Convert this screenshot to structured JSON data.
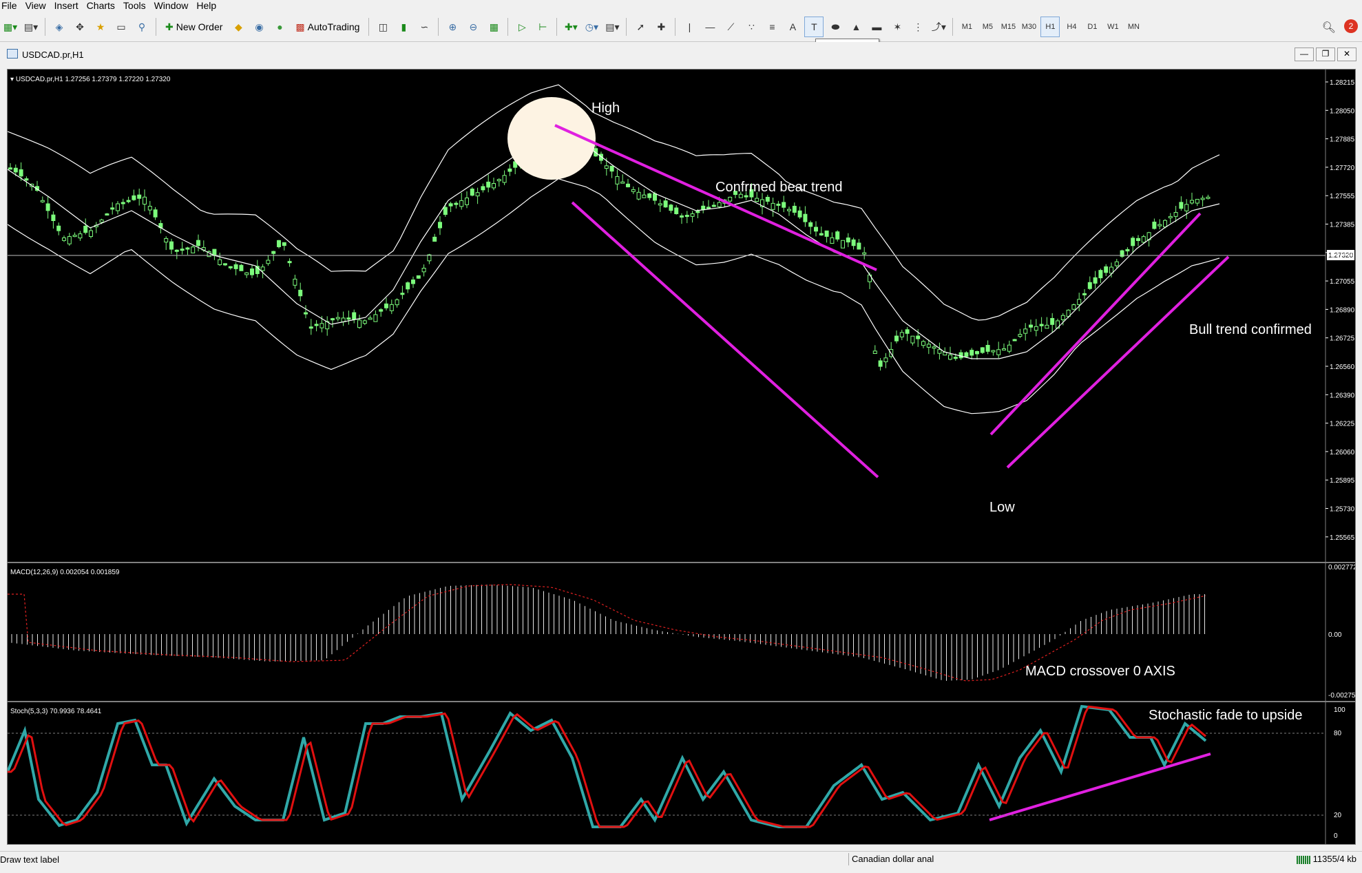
{
  "menu": [
    "File",
    "View",
    "Insert",
    "Charts",
    "Tools",
    "Window",
    "Help"
  ],
  "toolbar": {
    "new_order": "New Order",
    "auto_trading": "AutoTrading",
    "timeframes": [
      "M1",
      "M5",
      "M15",
      "M30",
      "H1",
      "H4",
      "D1",
      "W1",
      "MN"
    ],
    "active_timeframe": "H1",
    "tooltip": "Draw text label",
    "notification_count": "2",
    "icons": [
      "new-chart-icon",
      "profiles-icon",
      "market-watch-icon",
      "data-window-icon",
      "navigator-icon",
      "terminal-icon",
      "tester-icon",
      "metaeditor-icon",
      "signals-icon",
      "market-icon",
      "bar-chart-icon",
      "candle-chart-icon",
      "line-chart-icon",
      "zoom-in-icon",
      "zoom-out-icon",
      "tile-icon",
      "autoscroll-icon",
      "chart-shift-icon",
      "indicators-icon",
      "periods-icon",
      "templates-icon",
      "cursor-icon",
      "crosshair-icon",
      "vertical-line-icon",
      "horizontal-line-icon",
      "trendline-icon",
      "channel-icon",
      "fibo-icon",
      "text-icon",
      "text-label-icon",
      "ellipse-icon",
      "triangle-icon",
      "rectangle-icon",
      "gann-icon",
      "andrews-icon",
      "arrows-icon",
      "search-icon"
    ]
  },
  "chart_tab": "USDCAD.pr,H1",
  "chart": {
    "header": "USDCAD.pr,H1  1.27256 1.27379 1.27220 1.27320",
    "price_labels": [
      "1.28215",
      "1.28050",
      "1.27885",
      "1.27720",
      "1.27555",
      "1.27385",
      "1.27220",
      "1.27055",
      "1.26890",
      "1.26725",
      "1.26560",
      "1.26390",
      "1.26225",
      "1.26060",
      "1.25895",
      "1.25730",
      "1.25565"
    ],
    "current_price": "1.27320",
    "annotations": {
      "high": "High",
      "bear": "Confrmed bear trend",
      "low": "Low",
      "bull": "Bull trend confirmed",
      "macd": "MACD crossover 0 AXIS",
      "stoch": "Stochastic fade to upside"
    },
    "macd_header": "MACD(12,26,9) 0.002054 0.001859",
    "macd_labels": [
      "0.002772",
      "0.00",
      "-0.002753"
    ],
    "stoch_header": "Stoch(5,3,3) 70.9936 78.4641",
    "stoch_labels": [
      "100",
      "80",
      "20",
      "0"
    ],
    "colors": {
      "background": "#000000",
      "candles": "#7cfc7c",
      "bands": "#ffffff",
      "trendline": "#e020e0",
      "stoch_main": "#30a8a8",
      "stoch_signal": "#e01010",
      "macd_signal": "#e02020"
    }
  },
  "status": {
    "left": "Draw text label",
    "profile": "Canadian dollar anal",
    "traffic": "11355/4 kb"
  }
}
